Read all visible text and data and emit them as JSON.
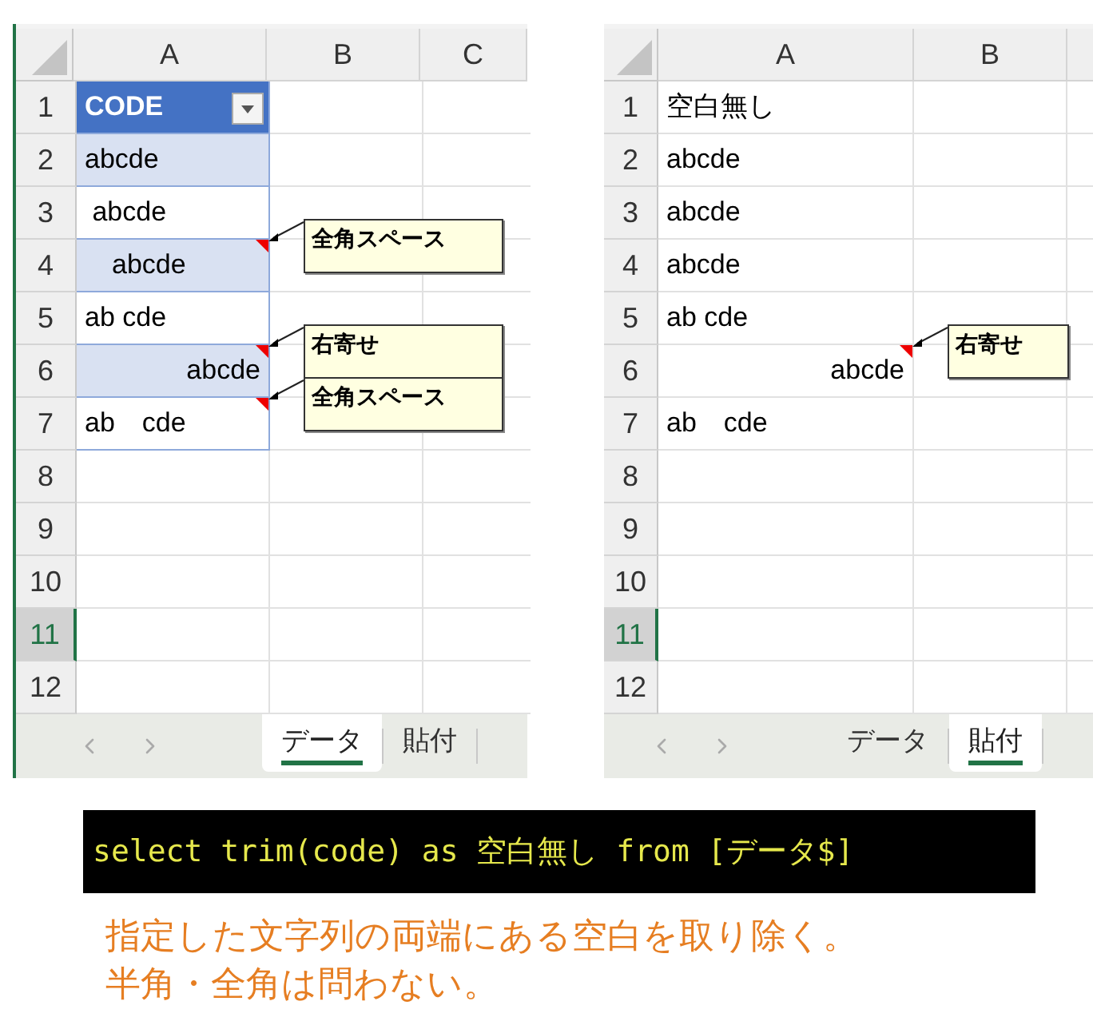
{
  "sheets": [
    {
      "columns": [
        "A",
        "B",
        "C"
      ],
      "rows": [
        {
          "number": "1",
          "value": "CODE",
          "kind": "header",
          "right_aligned": false,
          "selected": false
        },
        {
          "number": "2",
          "value": "abcde",
          "kind": "band",
          "right_aligned": false,
          "selected": false
        },
        {
          "number": "3",
          "value": " abcde",
          "kind": "plain",
          "right_aligned": false,
          "selected": false
        },
        {
          "number": "4",
          "value": "　abcde",
          "kind": "band",
          "right_aligned": false,
          "selected": false,
          "comment": "全角スペース"
        },
        {
          "number": "5",
          "value": "ab cde",
          "kind": "plain",
          "right_aligned": false,
          "selected": false
        },
        {
          "number": "6",
          "value": "abcde",
          "kind": "band",
          "right_aligned": true,
          "selected": false,
          "comment": "右寄せ"
        },
        {
          "number": "7",
          "value": "ab　cde",
          "kind": "plain",
          "right_aligned": false,
          "selected": false,
          "comment": "全角スペース"
        },
        {
          "number": "8",
          "kind": "empty",
          "selected": false
        },
        {
          "number": "9",
          "kind": "empty",
          "selected": false
        },
        {
          "number": "10",
          "kind": "empty",
          "selected": false
        },
        {
          "number": "11",
          "kind": "empty",
          "selected": true
        },
        {
          "number": "12",
          "kind": "empty",
          "selected": false
        }
      ],
      "tabs": [
        {
          "label": "データ",
          "selected": true
        },
        {
          "label": "貼付",
          "selected": false
        }
      ]
    },
    {
      "columns": [
        "A",
        "B"
      ],
      "rows": [
        {
          "number": "1",
          "value": "空白無し",
          "kind": "plain",
          "right_aligned": false,
          "selected": false
        },
        {
          "number": "2",
          "value": "abcde",
          "kind": "plain",
          "right_aligned": false,
          "selected": false
        },
        {
          "number": "3",
          "value": "abcde",
          "kind": "plain",
          "right_aligned": false,
          "selected": false
        },
        {
          "number": "4",
          "value": "abcde",
          "kind": "plain",
          "right_aligned": false,
          "selected": false
        },
        {
          "number": "5",
          "value": "ab cde",
          "kind": "plain",
          "right_aligned": false,
          "selected": false
        },
        {
          "number": "6",
          "value": "abcde",
          "kind": "plain",
          "right_aligned": true,
          "selected": false,
          "comment": "右寄せ"
        },
        {
          "number": "7",
          "value": "ab　cde",
          "kind": "plain",
          "right_aligned": false,
          "selected": false
        },
        {
          "number": "8",
          "kind": "empty",
          "selected": false
        },
        {
          "number": "9",
          "kind": "empty",
          "selected": false
        },
        {
          "number": "10",
          "kind": "empty",
          "selected": false
        },
        {
          "number": "11",
          "kind": "empty",
          "selected": true
        },
        {
          "number": "12",
          "kind": "empty",
          "selected": false
        }
      ],
      "tabs": [
        {
          "label": "データ",
          "selected": false
        },
        {
          "label": "貼付",
          "selected": true
        }
      ]
    }
  ],
  "code": "select trim(code) as 空白無し from [データ$]",
  "caption": [
    "指定した文字列の両端にある空白を取り除く。",
    "半角・全角は問わない。"
  ]
}
